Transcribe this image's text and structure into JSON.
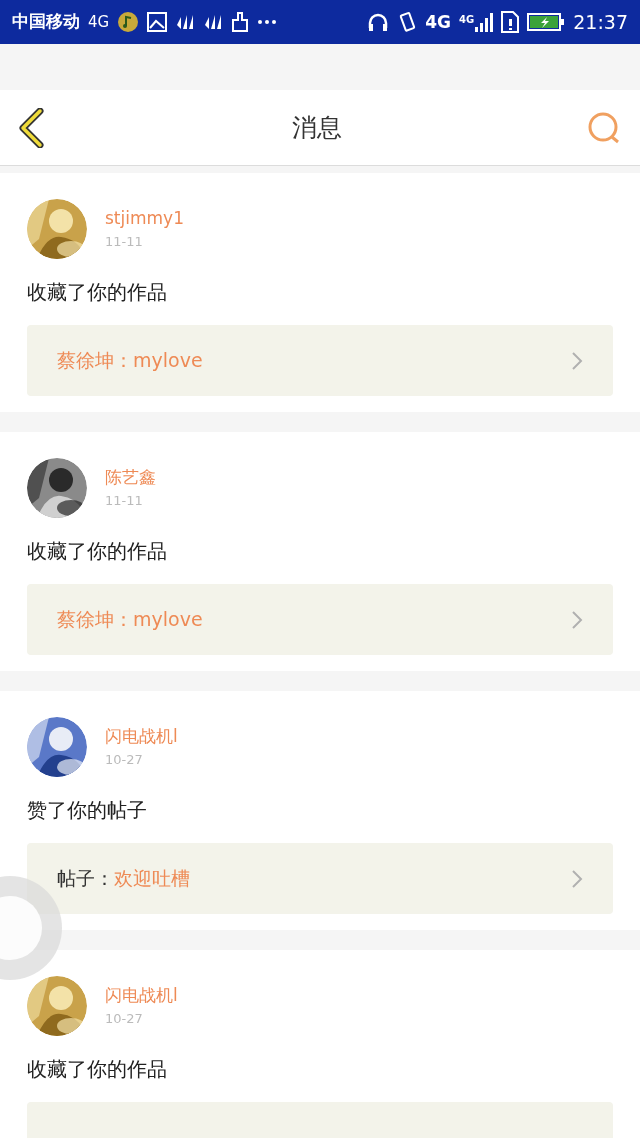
{
  "status_bar": {
    "carrier": "中国移动",
    "network": "4G",
    "data_network": "4G",
    "signal_network": "4G",
    "time": "21:37"
  },
  "header": {
    "title": "消息"
  },
  "messages": [
    {
      "user": "stjimmy1",
      "date": "11-11",
      "action": "收藏了你的作品",
      "ref": {
        "kind": "full",
        "target": "蔡徐坤：mylove"
      }
    },
    {
      "user": "陈艺鑫",
      "date": "11-11",
      "action": "收藏了你的作品",
      "ref": {
        "kind": "full",
        "target": "蔡徐坤：mylove"
      }
    },
    {
      "user": "闪电战机l",
      "date": "10-27",
      "action": "赞了你的帖子",
      "ref": {
        "kind": "full",
        "prefix": "帖子：",
        "target": "欢迎吐槽"
      }
    },
    {
      "user": "闪电战机l",
      "date": "10-27",
      "action": "收藏了你的作品",
      "ref": {
        "kind": "clipped"
      }
    }
  ]
}
